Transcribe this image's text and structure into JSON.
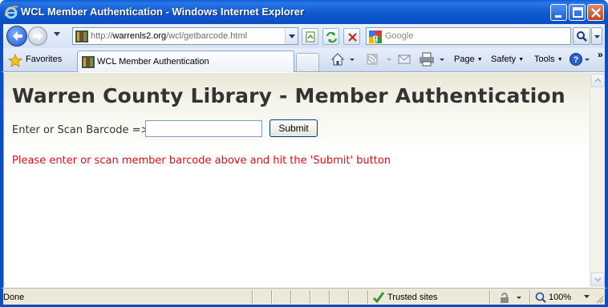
{
  "window": {
    "title": "WCL Member Authentication - Windows Internet Explorer"
  },
  "address_bar": {
    "url_prefix": "http://",
    "url_domain": "warrenls2.org",
    "url_path": "/wcl/getbarcode.html"
  },
  "search": {
    "placeholder": "Google"
  },
  "favorites": {
    "label": "Favorites"
  },
  "tab": {
    "label": "WCL Member Authentication"
  },
  "command_bar": {
    "page": "Page",
    "safety": "Safety",
    "tools": "Tools"
  },
  "page": {
    "title": "Warren County Library - Member Authentication",
    "barcode_label": "Enter or Scan Barcode =>",
    "barcode_value": "",
    "submit_label": "Submit",
    "message": "Please enter or scan member barcode above and hit the 'Submit' button"
  },
  "status_bar": {
    "status": "Done",
    "zone": "Trusted sites",
    "zoom": "100%"
  },
  "colors": {
    "title_bar": "#0a5fd6",
    "message": "#d8121b",
    "heading": "#333333"
  }
}
